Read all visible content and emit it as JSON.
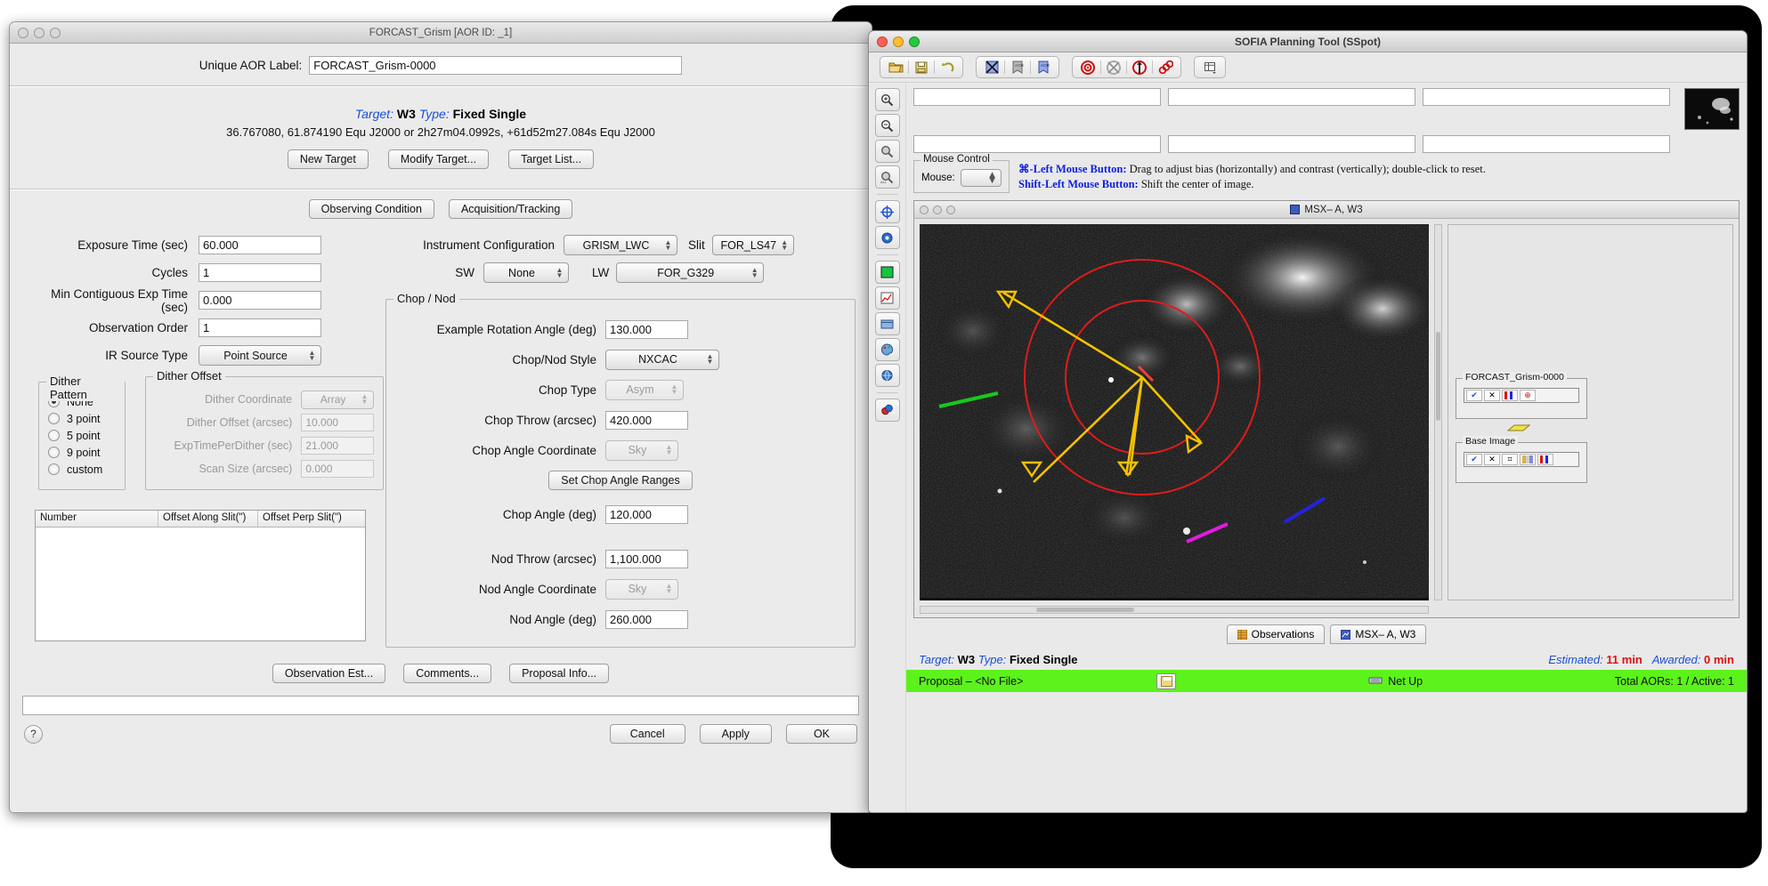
{
  "aor_window": {
    "title": "FORCAST_Grism [AOR ID: _1]",
    "label_field": {
      "label": "Unique AOR Label:",
      "value": "FORCAST_Grism-0000"
    },
    "target": {
      "target_key": "Target:",
      "target_value": "W3",
      "type_key": "Type:",
      "type_value": "Fixed Single",
      "coords": "36.767080, 61.874190  Equ J2000    or    2h27m04.0992s, +61d52m27.084s  Equ J2000",
      "buttons": [
        "New Target",
        "Modify Target...",
        "Target List..."
      ]
    },
    "tabs": [
      "Observing Condition",
      "Acquisition/Tracking"
    ],
    "left_fields": [
      {
        "label": "Exposure Time (sec)",
        "value": "60.000",
        "kind": "text"
      },
      {
        "label": "Cycles",
        "value": "1",
        "kind": "text"
      },
      {
        "label": "Min Contiguous Exp Time (sec)",
        "value": "0.000",
        "kind": "text"
      },
      {
        "label": "Observation Order",
        "value": "1",
        "kind": "text"
      },
      {
        "label": "IR Source Type",
        "value": "Point Source",
        "kind": "select"
      }
    ],
    "dither_pattern": {
      "title": "Dither Pattern",
      "options": [
        "None",
        "3 point",
        "5 point",
        "9 point",
        "custom"
      ],
      "selected": "None"
    },
    "dither_offset": {
      "title": "Dither Offset",
      "rows": [
        {
          "label": "Dither Coordinate",
          "value": "Array",
          "kind": "select",
          "disabled": true
        },
        {
          "label": "Dither Offset (arcsec)",
          "value": "10.000",
          "kind": "text",
          "disabled": true
        },
        {
          "label": "ExpTimePerDither (sec)",
          "value": "21.000",
          "kind": "text",
          "disabled": true
        },
        {
          "label": "Scan Size (arcsec)",
          "value": "0.000",
          "kind": "text",
          "disabled": true
        }
      ]
    },
    "offset_table": {
      "headers": [
        "Number",
        "Offset Along Slit(\")",
        "Offset Perp Slit(\")"
      ],
      "rows": []
    },
    "instrument": {
      "config_label": "Instrument Configuration",
      "config_value": "GRISM_LWC",
      "slit_label": "Slit",
      "slit_value": "FOR_LS47",
      "sw_label": "SW",
      "sw_value": "None",
      "lw_label": "LW",
      "lw_value": "FOR_G329"
    },
    "chop_nod": {
      "title": "Chop / Nod",
      "rows": [
        {
          "label": "Example Rotation Angle (deg)",
          "value": "130.000",
          "kind": "text",
          "disabled": false
        },
        {
          "label": "Chop/Nod Style",
          "value": "NXCAC",
          "kind": "select",
          "disabled": false
        },
        {
          "label": "Chop Type",
          "value": "Asym",
          "kind": "select",
          "disabled": true
        },
        {
          "label": "Chop Throw (arcsec)",
          "value": "420.000",
          "kind": "text",
          "disabled": false
        },
        {
          "label": "Chop Angle Coordinate",
          "value": "Sky",
          "kind": "select",
          "disabled": true
        }
      ],
      "set_chop_button": "Set Chop Angle Ranges",
      "rows2": [
        {
          "label": "Chop Angle (deg)",
          "value": "120.000",
          "kind": "text",
          "disabled": false
        },
        {
          "label": "Nod Throw (arcsec)",
          "value": "1,100.000",
          "kind": "text",
          "disabled": false
        },
        {
          "label": "Nod Angle Coordinate",
          "value": "Sky",
          "kind": "select",
          "disabled": true
        },
        {
          "label": "Nod Angle (deg)",
          "value": "260.000",
          "kind": "text",
          "disabled": false
        }
      ]
    },
    "bottom_buttons": [
      "Observation Est...",
      "Comments...",
      "Proposal Info..."
    ],
    "footer_value": "",
    "help_glyph": "?",
    "dialog_buttons": [
      "Cancel",
      "Apply",
      "OK"
    ]
  },
  "sspot_window": {
    "title": "SOFIA Planning Tool (SSpot)",
    "toolbar": {
      "groups": [
        [
          {
            "name": "open-folder-icon",
            "glyph": "📂"
          },
          {
            "name": "save-floppy-icon",
            "glyph": "💾"
          },
          {
            "name": "undo-icon",
            "glyph": "↺"
          }
        ],
        [
          {
            "name": "delete-aor-icon",
            "glyph": "⌧"
          },
          {
            "name": "duplicate-aor-icon",
            "glyph": "AOR"
          },
          {
            "name": "new-aor-icon",
            "glyph": "AOR"
          }
        ],
        [
          {
            "name": "target-icon",
            "glyph": "◎"
          },
          {
            "name": "target-disabled-icon",
            "glyph": "⌧"
          },
          {
            "name": "target-up-icon",
            "glyph": "↑"
          },
          {
            "name": "target-chain-icon",
            "glyph": "◎"
          }
        ],
        [
          {
            "name": "table-view-icon",
            "glyph": "▦"
          }
        ]
      ]
    },
    "sidebar_buttons": [
      {
        "name": "zoom-in-icon",
        "glyph": "⊕"
      },
      {
        "name": "zoom-out-icon",
        "glyph": "⊖"
      },
      {
        "name": "zoom-fit-icon",
        "glyph": "⊙"
      },
      {
        "name": "zoom-all-icon",
        "glyph": "⊚"
      },
      {
        "name": "crosshair-icon",
        "glyph": "⌖"
      },
      {
        "name": "center-target-icon",
        "glyph": "☉"
      },
      {
        "name": "grid-icon",
        "glyph": "▦"
      },
      {
        "name": "chart-icon",
        "glyph": "◰"
      },
      {
        "name": "layers-icon",
        "glyph": "▤"
      },
      {
        "name": "palette-icon",
        "glyph": "◐"
      },
      {
        "name": "globe-icon",
        "glyph": "♁"
      },
      {
        "name": "markers-icon",
        "glyph": "◔"
      }
    ],
    "readouts": [
      "",
      "",
      "",
      ""
    ],
    "mouse_control": {
      "title": "Mouse Control",
      "row_label": "Mouse:",
      "value": ""
    },
    "mouse_help": [
      {
        "key": "⌘-Left Mouse Button:",
        "text": " Drag to adjust bias (horizontally) and contrast (vertically); double-click to reset."
      },
      {
        "key": "Shift-Left Mouse Button:",
        "text": " Shift the center of image."
      }
    ],
    "image_panel": {
      "title": "MSX– A,  W3",
      "icon_name": "image-layer-icon"
    },
    "layers": {
      "overlay_box": {
        "title": "FORCAST_Grism-0000"
      },
      "base_box": {
        "title": "Base Image"
      }
    },
    "tabs": [
      {
        "label": "Observations",
        "icon": "observations-icon"
      },
      {
        "label": "MSX– A,  W3",
        "icon": "image-tab-icon"
      }
    ],
    "status": {
      "target_key": "Target:",
      "target_value": "W3",
      "type_key": "Type:",
      "type_value": "Fixed Single",
      "estimated_key": "Estimated:",
      "estimated_value": "11 min",
      "awarded_key": "Awarded:",
      "awarded_value": "0 min"
    },
    "green_bar": {
      "proposal": "Proposal – <No File>",
      "save_icon": "save-proposal-icon",
      "net_up": "Net Up",
      "net_icon": "network-icon",
      "totals": "Total AORs: 1 / Active:  1"
    }
  },
  "colors": {
    "accent_blue": "#1a4fd6",
    "status_green": "#5cf21c",
    "red": "#d11111",
    "window_gray": "#ebebeb"
  }
}
